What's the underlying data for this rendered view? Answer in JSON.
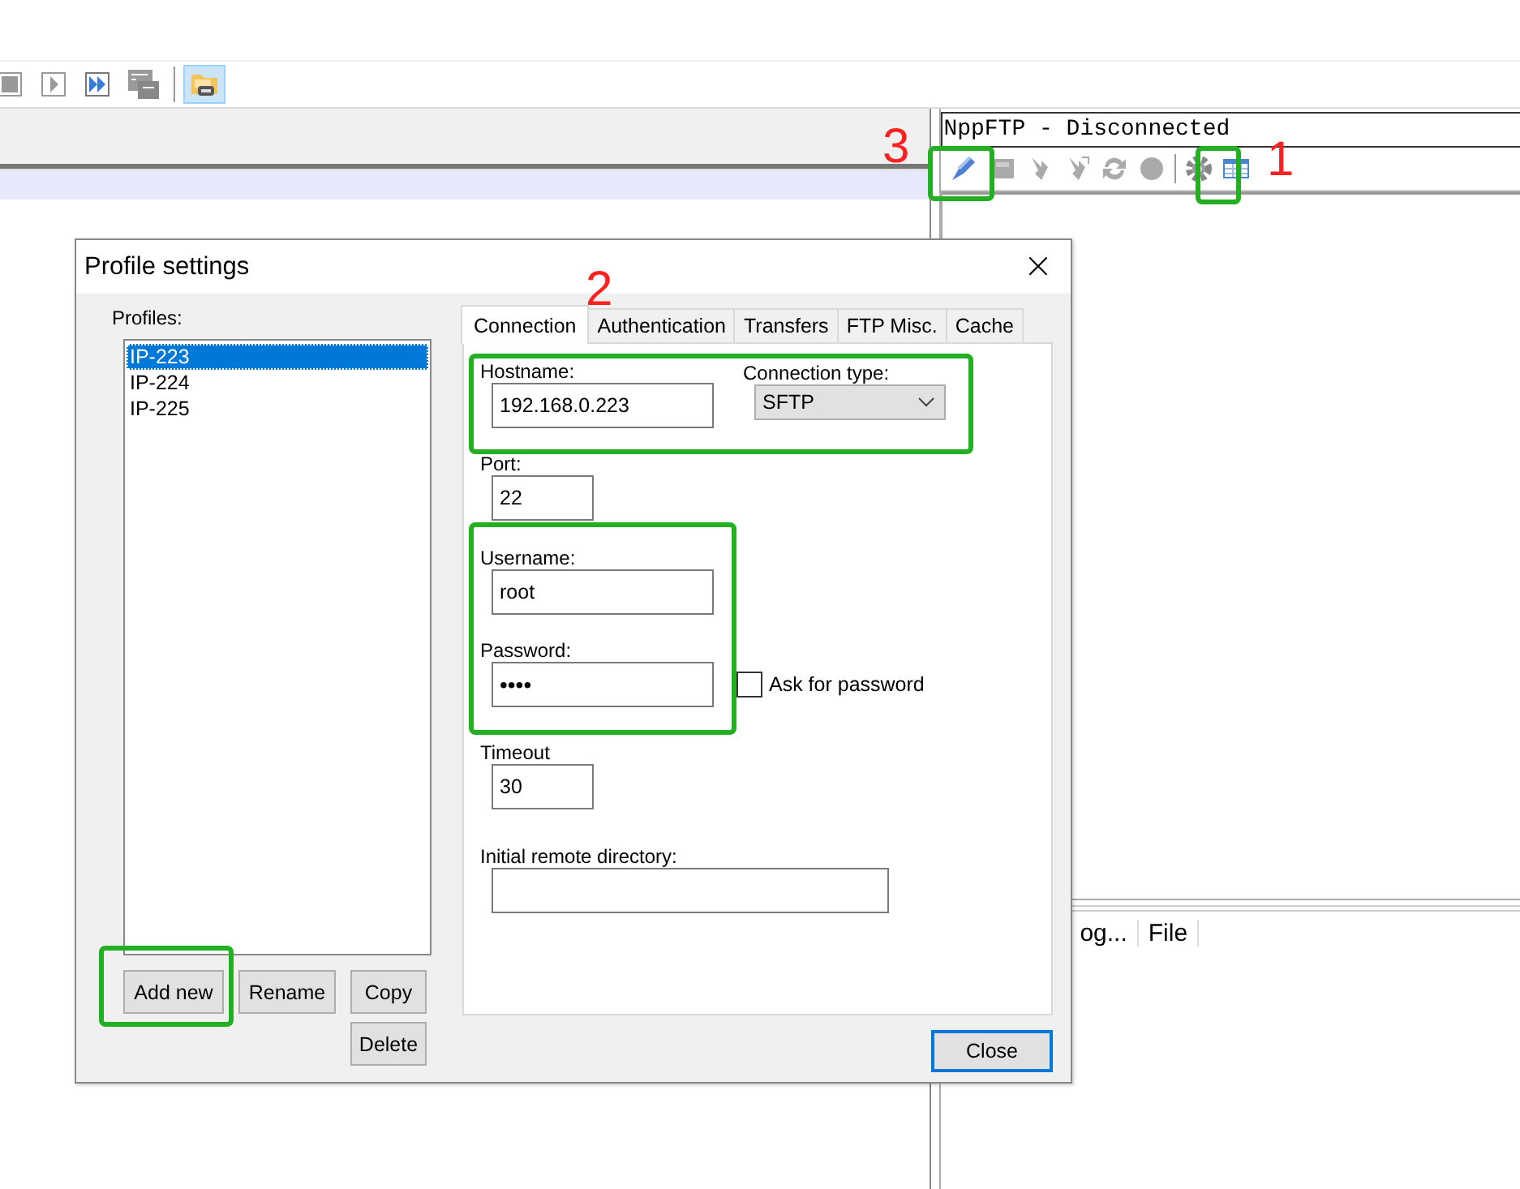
{
  "toolbar": {
    "buttons": [
      {
        "kind": "stop",
        "selected": false
      },
      {
        "kind": "play",
        "selected": false
      },
      {
        "kind": "fast-forward",
        "selected": false
      },
      {
        "kind": "macro",
        "selected": false
      },
      {
        "kind": "folder",
        "selected": true
      }
    ]
  },
  "ftp_panel": {
    "title": "NppFTP - Disconnected",
    "tools": [
      {
        "kind": "connect"
      },
      {
        "kind": "disk"
      },
      {
        "kind": "download"
      },
      {
        "kind": "upload"
      },
      {
        "kind": "refresh"
      },
      {
        "kind": "abort"
      },
      {
        "kind": "settings"
      },
      {
        "kind": "queue"
      }
    ],
    "columns": [
      "og...",
      "File"
    ]
  },
  "dialog": {
    "title": "Profile settings",
    "close": "×",
    "profiles_label": "Profiles:",
    "profiles": [
      {
        "name": "IP-223",
        "selected": true
      },
      {
        "name": "IP-224",
        "selected": false
      },
      {
        "name": "IP-225",
        "selected": false
      }
    ],
    "profile_buttons": [
      "Add new",
      "Rename",
      "Copy",
      "Delete"
    ],
    "tabs": [
      {
        "label": "Connection",
        "selected": true
      },
      {
        "label": "Authentication",
        "selected": false
      },
      {
        "label": "Transfers",
        "selected": false
      },
      {
        "label": "FTP Misc.",
        "selected": false
      },
      {
        "label": "Cache",
        "selected": false
      }
    ],
    "hostname": {
      "label": "Hostname:",
      "value": "192.168.0.223"
    },
    "connection_type": {
      "label": "Connection type:",
      "value": "SFTP"
    },
    "port": {
      "label": "Port:",
      "value": "22"
    },
    "username": {
      "label": "Username:",
      "value": "root"
    },
    "password": {
      "label": "Password:",
      "value": "••••"
    },
    "ask_password": {
      "label": "Ask for password",
      "checked": false
    },
    "timeout": {
      "label": "Timeout",
      "value": "30"
    },
    "remote_dir": {
      "label": "Initial remote directory:"
    },
    "close_button": "Close"
  },
  "annotations": [
    "1",
    "2",
    "3"
  ]
}
